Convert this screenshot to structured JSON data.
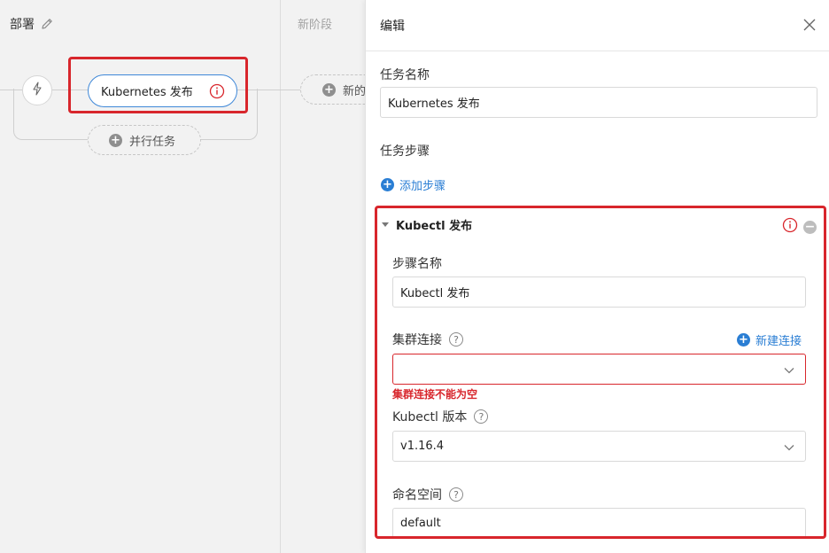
{
  "canvas": {
    "stage_deploy_title": "部署",
    "stage_new_title": "新阶段",
    "task_node_label": "Kubernetes 发布",
    "parallel_task_label": "并行任务",
    "new_task_label": "新的"
  },
  "drawer": {
    "title": "编辑",
    "task_name_label": "任务名称",
    "task_name_value": "Kubernetes 发布",
    "task_steps_label": "任务步骤",
    "add_step_label": "添加步骤",
    "step": {
      "header": "Kubectl 发布",
      "step_name_label": "步骤名称",
      "step_name_value": "Kubectl 发布",
      "cluster_label": "集群连接",
      "new_connection_label": "新建连接",
      "cluster_value": "",
      "cluster_error": "集群连接不能为空",
      "kubectl_version_label": "Kubectl 版本",
      "kubectl_version_value": "v1.16.4",
      "namespace_label": "命名空间",
      "namespace_value": "default"
    }
  },
  "icons": {
    "help": "?",
    "plus": "+",
    "minus": "−"
  },
  "colors": {
    "accent": "#2a7ed4",
    "error": "#d8262c",
    "node_border": "#3f88d8"
  }
}
